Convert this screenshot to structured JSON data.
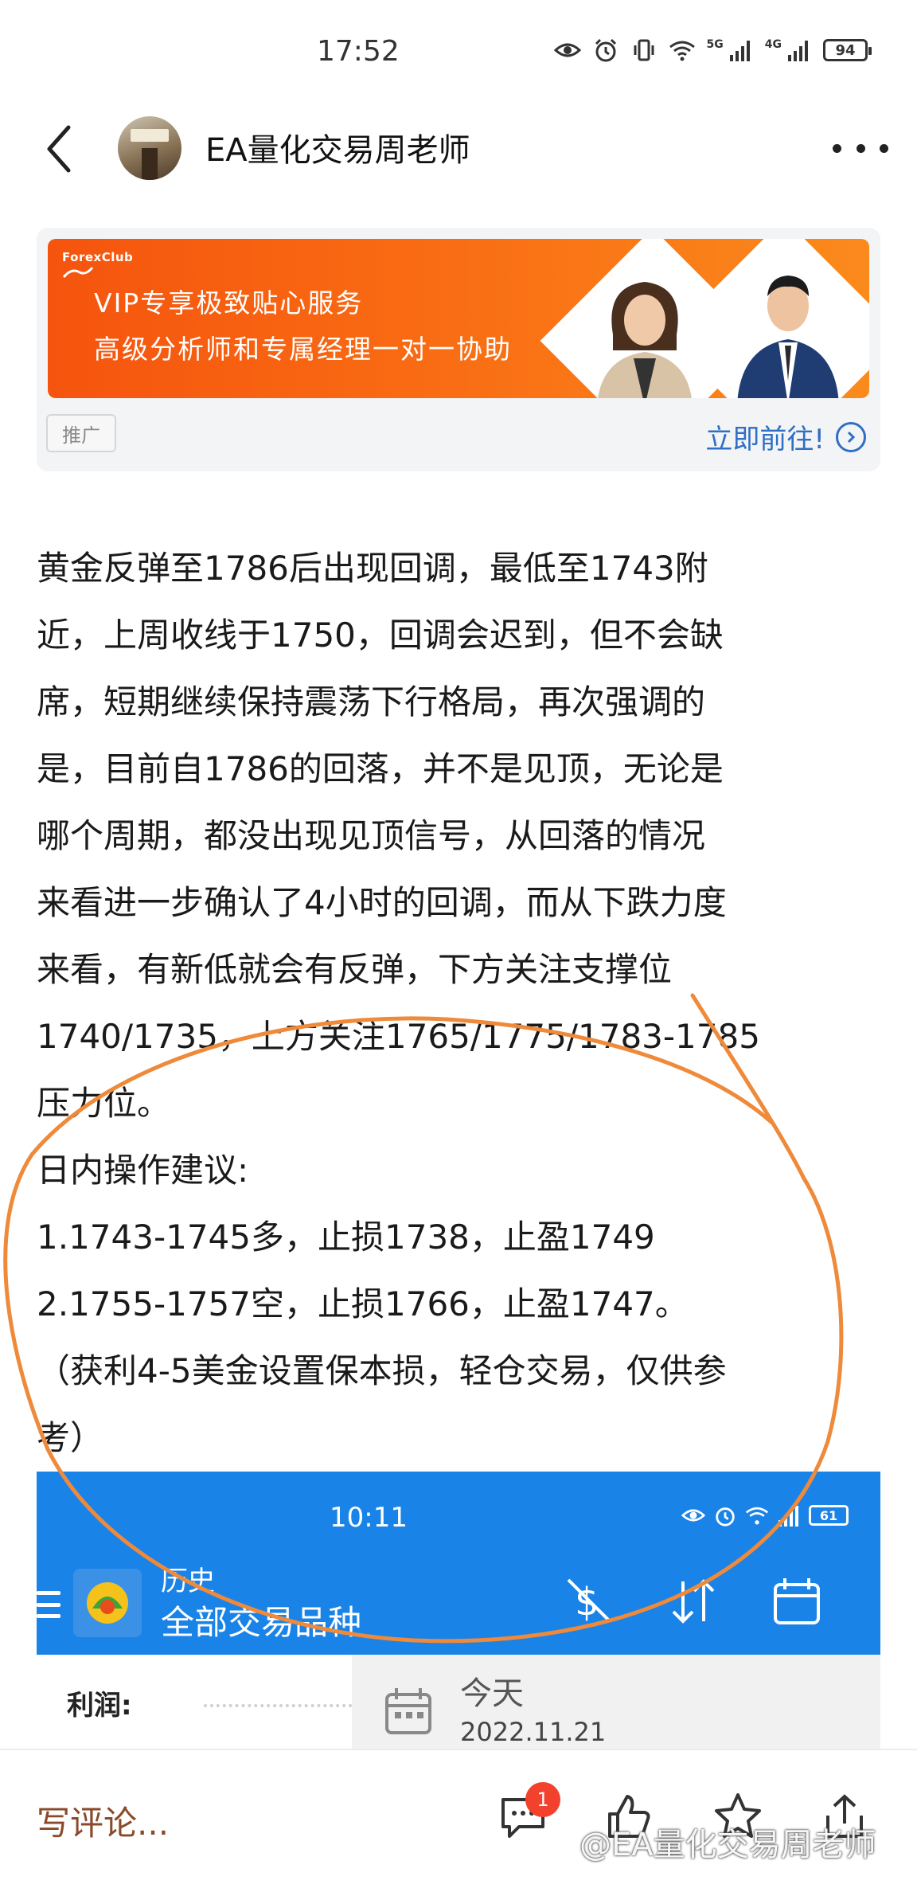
{
  "status_bar": {
    "time": "17:52",
    "signal_1": "5G",
    "signal_2": "4G",
    "battery": "94",
    "icons": [
      "eye-icon",
      "alarm-icon",
      "vibrate-icon",
      "wifi-icon",
      "cell-signal-icon",
      "cell-signal-icon"
    ]
  },
  "header": {
    "author_name": "EA量化交易周老师"
  },
  "ad": {
    "brand": "ForexClub",
    "line1": "VIP专享极致贴心服务",
    "line2": "高级分析师和专属经理一对一协助",
    "tag": "推广",
    "cta": "立即前往!",
    "accent": "#f96b13",
    "cta_color": "#2f6fc4"
  },
  "article": {
    "lines": [
      "黄金反弹至1786后出现回调，最低至1743附",
      "近，上周收线于1750，回调会迟到，但不会缺",
      "席，短期继续保持震荡下行格局，再次强调的",
      "是，目前自1786的回落，并不是见顶，无论是",
      "哪个周期，都没出现见顶信号，从回落的情况",
      "来看进一步确认了4小时的回调，而从下跌力度",
      "来看，有新低就会有反弹，下方关注支撑位",
      "1740/1735，上方关注1765/1775/1783-1785",
      "压力位。",
      "日内操作建议:",
      "1.1743-1745多，止损1738，止盈1749",
      "2.1755-1757空，止损1766，止盈1747。",
      "（获利4-5美金设置保本损，轻仓交易，仅供参",
      "考）"
    ]
  },
  "embedded_screenshot": {
    "time": "10:11",
    "battery": "61",
    "section_label": "历史",
    "title": "全部交易品种",
    "profit_label": "利润:",
    "date_heading": "今天",
    "date_value": "2022.11.21",
    "header_color": "#1a83e8"
  },
  "bottom_bar": {
    "comment_placeholder": "写评论...",
    "comment_count": "1",
    "watermark": "@EA量化交易周老师"
  }
}
